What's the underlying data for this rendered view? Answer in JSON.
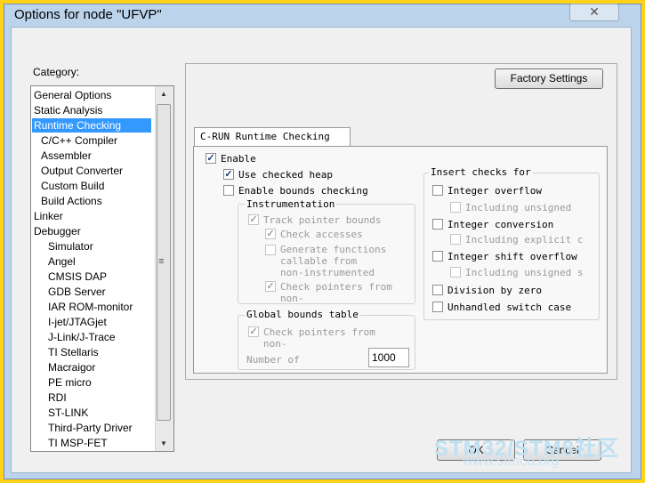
{
  "window": {
    "title": "Options for node \"UFVP\"",
    "close_glyph": "✕"
  },
  "category": {
    "label": "Category:",
    "items": [
      "General Options",
      "Static Analysis",
      "Runtime Checking",
      "C/C++ Compiler",
      "Assembler",
      "Output Converter",
      "Custom Build",
      "Build Actions",
      "Linker",
      "Debugger",
      "Simulator",
      "Angel",
      "CMSIS DAP",
      "GDB Server",
      "IAR ROM-monitor",
      "I-jet/JTAGjet",
      "J-Link/J-Trace",
      "TI Stellaris",
      "Macraigor",
      "PE micro",
      "RDI",
      "ST-LINK",
      "Third-Party Driver",
      "TI MSP-FET"
    ],
    "selected_index": 2,
    "scroll_up": "▲",
    "scroll_down": "▼",
    "grip": "≡"
  },
  "buttons": {
    "factory_settings": "Factory Settings",
    "ok": "OK",
    "cancel": "Cancel"
  },
  "tab": {
    "label": "C-RUN Runtime Checking"
  },
  "left": {
    "enable": "Enable",
    "use_checked_heap": "Use checked heap",
    "enable_bounds": "Enable bounds checking",
    "instrumentation": {
      "label": "Instrumentation",
      "track": "Track pointer bounds",
      "check_accesses": "Check accesses",
      "gen1": "Generate functions",
      "gen2": "callable from",
      "gen3": "non-instrumented",
      "cpf1": "Check pointers from",
      "cpf2": "non-"
    },
    "global": {
      "label": "Global bounds table",
      "cpf1": "Check pointers from",
      "cpf2": "non-",
      "number_label": "Number of",
      "number_value": "1000"
    }
  },
  "right": {
    "label": "Insert checks for",
    "int_overflow": "Integer overflow",
    "incl_unsigned": "Including unsigned",
    "int_conversion": "Integer conversion",
    "incl_explicit": "Including explicit c",
    "int_shift": "Integer shift overflow",
    "incl_unsigned_s": "Including unsigned s",
    "div_zero": "Division by zero",
    "unhandled_switch": "Unhandled switch case"
  },
  "watermark": {
    "line1": "STM32/STM8社区",
    "line2": "www.stmcu.org"
  },
  "check_glyph": "✓"
}
